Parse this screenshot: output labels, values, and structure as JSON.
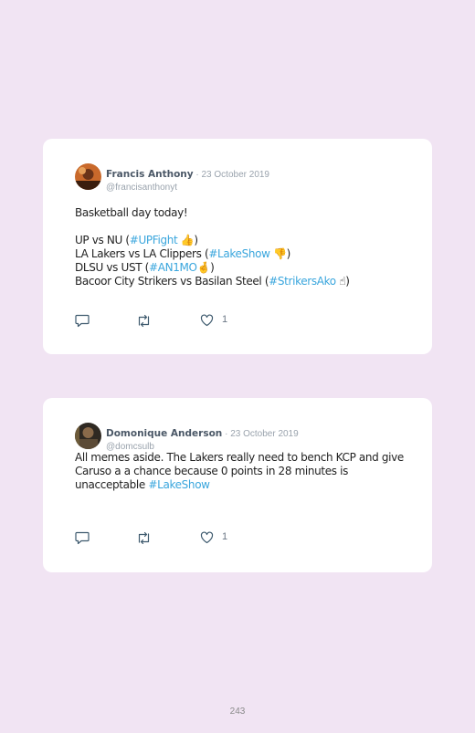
{
  "tweets": [
    {
      "author": "Francis Anthony",
      "separator": " · ",
      "date": "23 October 2019",
      "handle": "@francisanthonyt",
      "lines": [
        [
          {
            "t": "Basketball day today!"
          }
        ],
        [],
        [
          {
            "t": "UP vs NU ("
          },
          {
            "t": "#UPFight",
            "tag": true
          },
          {
            "t": " 👍)"
          }
        ],
        [
          {
            "t": "LA Lakers vs LA Clippers ("
          },
          {
            "t": "#LakeShow",
            "tag": true
          },
          {
            "t": " 👎)"
          }
        ],
        [
          {
            "t": "DLSU vs UST ("
          },
          {
            "t": "#AN1MO",
            "tag": true
          },
          {
            "t": "🤞)"
          }
        ],
        [
          {
            "t": "Bacoor City Strikers vs Basilan Steel ("
          },
          {
            "t": "#StrikersAko",
            "tag": true
          },
          {
            "t": " ☝)"
          }
        ]
      ],
      "likes": "1"
    },
    {
      "author": "Domonique Anderson",
      "separator": " · ",
      "date": "23 October 2019",
      "handle": "@domcsulb",
      "lines": [
        [
          {
            "t": "All memes aside. The Lakers really need to bench KCP and give Caruso a a chance because 0 points in 28 minutes is unacceptable "
          },
          {
            "t": "#LakeShow",
            "tag": true
          }
        ]
      ],
      "likes": "1"
    }
  ],
  "icons": {
    "reply": "speech-bubble-icon",
    "retweet": "retweet-arrows-icon",
    "like": "heart-outline-icon"
  },
  "colors": {
    "background": "#f1e4f3",
    "card": "#ffffff",
    "hashtag": "#3aa6dd",
    "author": "#4b5867",
    "muted": "#9aa3ad"
  },
  "page_number": "243"
}
